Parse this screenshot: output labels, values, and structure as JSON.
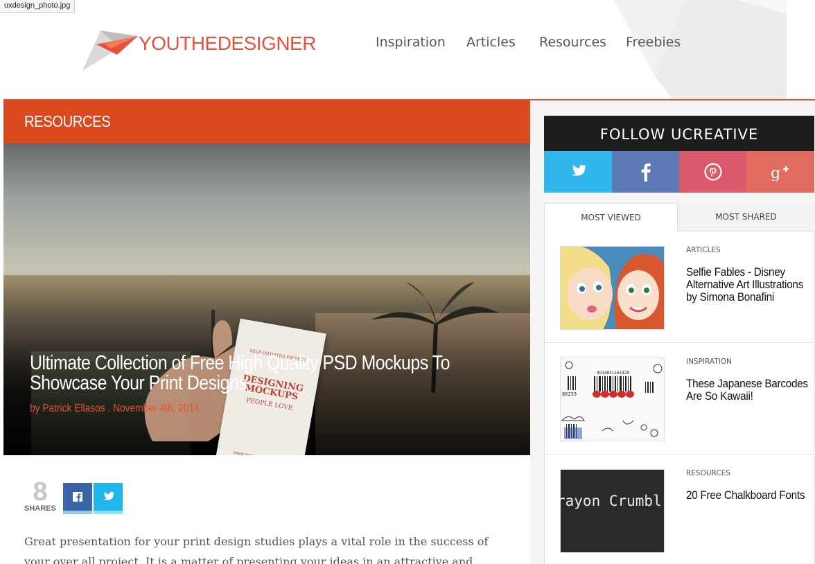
{
  "tooltip": {
    "text": "uxdesign_photo.jpg"
  },
  "brand": {
    "part1": "YOU",
    "part2": "THE",
    "part3": "DESIGNER",
    "accent": "#e8503a"
  },
  "nav": {
    "items": [
      "Inspiration",
      "Articles",
      "Resources",
      "Freebies"
    ]
  },
  "section": {
    "label": "RESOURCES",
    "color": "#da4a1e"
  },
  "hero": {
    "title": "Ultimate Collection of Free High Quality PSD Mockups To Showcase Your Print Designs",
    "author_prefix": "by",
    "author": "Patrick Ellasos",
    "separator": ".",
    "date": "November 4th, 2014",
    "card": {
      "top": "SELF-INITIATED PROJECT",
      "headline": "DESIGNING MOCKUPS",
      "sub": "PEOPLE LOVE",
      "url": "WWW.ORIGINALMOCKUPS.COM"
    }
  },
  "share": {
    "count": "8",
    "label": "SHARES",
    "buttons": [
      "facebook-icon",
      "twitter-icon"
    ]
  },
  "body": {
    "text": "Great presentation for your print design studies plays a vital role in the success of your over all project. It is a matter of presenting your ideas in an attractive and professional manner."
  },
  "sidebar": {
    "follow_title": "FOLLOW UCREATIVE",
    "social": [
      "twitter-icon",
      "facebook-icon",
      "pinterest-icon",
      "google-plus-icon"
    ],
    "tabs": [
      "MOST VIEWED",
      "MOST SHARED"
    ],
    "posts": [
      {
        "category": "ARTICLES",
        "title": "Selfie Fables - Disney Alternative Art Illustrations by Simona Bonafini"
      },
      {
        "category": "INSPIRATION",
        "title": "These Japanese Barcodes Are So Kawaii!",
        "thumb_number": "4934031161420",
        "thumb_code": "86233"
      },
      {
        "category": "RESOURCES",
        "title": "20 Free Chalkboard Fonts",
        "thumb_text": "rayon Crumbl"
      }
    ]
  }
}
